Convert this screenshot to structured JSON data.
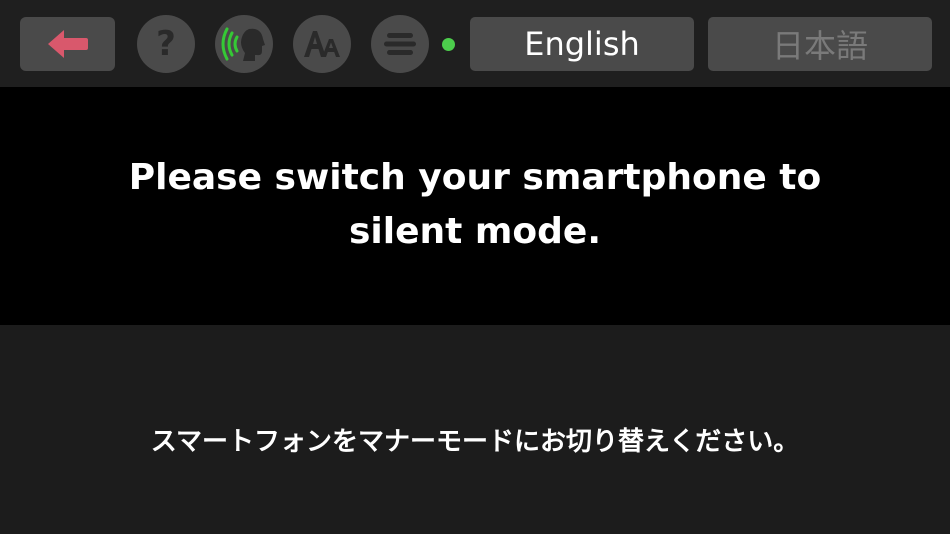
{
  "colors": {
    "back_arrow": "#d9586c",
    "voice_waves": "#35c935",
    "status_dot": "#4ccd4c",
    "button_bg": "#4a4a4a",
    "icon_muted": "#2a2a2a"
  },
  "toolbar": {
    "back_icon": "left-arrow-icon",
    "help_icon": "question-mark-icon",
    "voice_icon": "speaking-head-icon",
    "font_icon": "font-size-icon",
    "menu_icon": "menu-lines-icon",
    "status": "connected-dot",
    "languages": [
      {
        "label": "English",
        "selected": true
      },
      {
        "label": "日本語",
        "selected": false
      }
    ]
  },
  "message": {
    "primary": "Please switch your smartphone to silent mode.",
    "secondary": "スマートフォンをマナーモードにお切り替えください。"
  }
}
